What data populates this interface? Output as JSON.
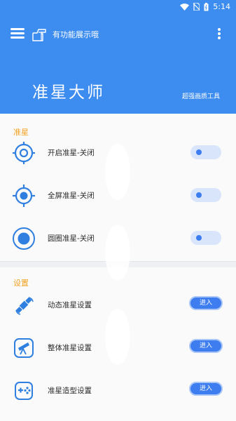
{
  "status_bar": {
    "time": "5:14"
  },
  "toolbar": {
    "notice_text": "有功能展示哦"
  },
  "header": {
    "title": "准星大师",
    "subtitle": "超强画质工具"
  },
  "sections": {
    "crosshair": {
      "title": "准星",
      "items": [
        {
          "label": "开启准星-关闭",
          "icon": "crosshair-target-icon"
        },
        {
          "label": "全屏准星-关闭",
          "icon": "crosshair-fullscreen-icon"
        },
        {
          "label": "圆圈准星-关闭",
          "icon": "circle-crosshair-icon"
        }
      ]
    },
    "settings": {
      "title": "设置",
      "items": [
        {
          "label": "动态准星设置",
          "button": "进入",
          "icon": "satellite-icon"
        },
        {
          "label": "整体准星设置",
          "button": "进入",
          "icon": "telescope-icon"
        },
        {
          "label": "准星造型设置",
          "button": "进入",
          "icon": "gamepad-icon"
        }
      ]
    }
  },
  "colors": {
    "primary": "#3d8cf0",
    "accent": "#f2a221",
    "button": "#3d7df0"
  }
}
